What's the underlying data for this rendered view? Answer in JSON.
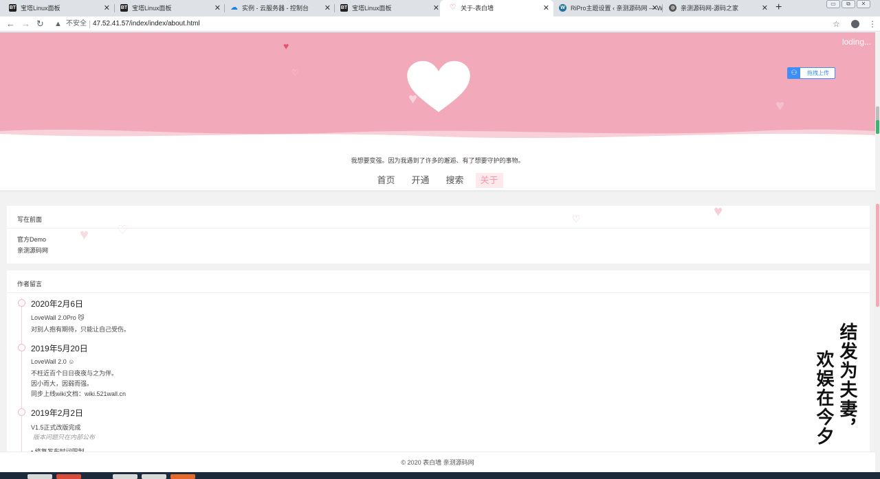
{
  "browser": {
    "tabs": [
      {
        "title": "宝塔Linux面板",
        "favicon": "bt-icon"
      },
      {
        "title": "宝塔Linux面板",
        "favicon": "bt-icon"
      },
      {
        "title": "实例 - 云服务器 - 控制台",
        "favicon": "cloud-icon"
      },
      {
        "title": "宝塔Linux面板",
        "favicon": "bt-icon"
      },
      {
        "title": "关于-表白墙",
        "favicon": "heart-icon",
        "active": true
      },
      {
        "title": "RiPro主题设置 ‹ 亲测源码网 — W",
        "favicon": "wordpress-icon"
      },
      {
        "title": "亲测源码网-源码之家",
        "favicon": "globe-icon"
      }
    ],
    "favicon_glyphs": {
      "bt": "BT",
      "cloud": "☁",
      "wp": "W",
      "globe": "◍",
      "heart": "♡"
    },
    "new_tab": "+",
    "close_glyph": "✕",
    "nav_glyphs": {
      "back": "←",
      "forward": "→",
      "reload": "↻",
      "warning": "▲",
      "star": "☆",
      "menu": "⋮"
    },
    "window_glyphs": {
      "minimize": "▭",
      "restore": "⧉",
      "close": "✕"
    },
    "security_label": "不安全",
    "url": "47.52.41.57/index/index/about.html"
  },
  "page": {
    "loading": "loding...",
    "upload_label": "拖拽上传",
    "upload_glyph": "⚇",
    "motto": "我想要变强。因为我遇到了许多的邂逅、有了想要守护的事物。",
    "nav": [
      {
        "label": "首页"
      },
      {
        "label": "开通"
      },
      {
        "label": "搜索"
      },
      {
        "label": "关于",
        "active": true
      }
    ],
    "deco_heart": "♥",
    "deco_heart_outline": "♡",
    "intro": {
      "title": "写在前面",
      "links": [
        "官方Demo",
        "亲测源码网"
      ]
    },
    "author_notes": {
      "title": "作者留言",
      "entries": [
        {
          "date": "2020年2月6日",
          "lines": [
            "LoveWall 2.0Pro 😼",
            "对别人抱有期待，只能让自己受伤。"
          ]
        },
        {
          "date": "2019年5月20日",
          "lines": [
            "LoveWall 2.0 ☺",
            "不枉近百个日日夜夜与之为伴。",
            "因小而大，因弱而强。",
            "同步上线wiki文档：wiki.521wall.cn"
          ]
        },
        {
          "date": "2019年2月2日",
          "lines": [
            "V1.5正式改版完成"
          ],
          "muted": "版本问题只在内部公布",
          "bullet": "• 修复发布时间限制"
        }
      ]
    },
    "calligraphy": {
      "right": "结发为夫妻，",
      "left": "欢娱在今夕"
    },
    "footer": "© 2020 表白墙  亲测源码网"
  },
  "colors": {
    "hero": "#f2a9b9",
    "accent": "#f39aae",
    "upload": "#3e8ef7"
  }
}
